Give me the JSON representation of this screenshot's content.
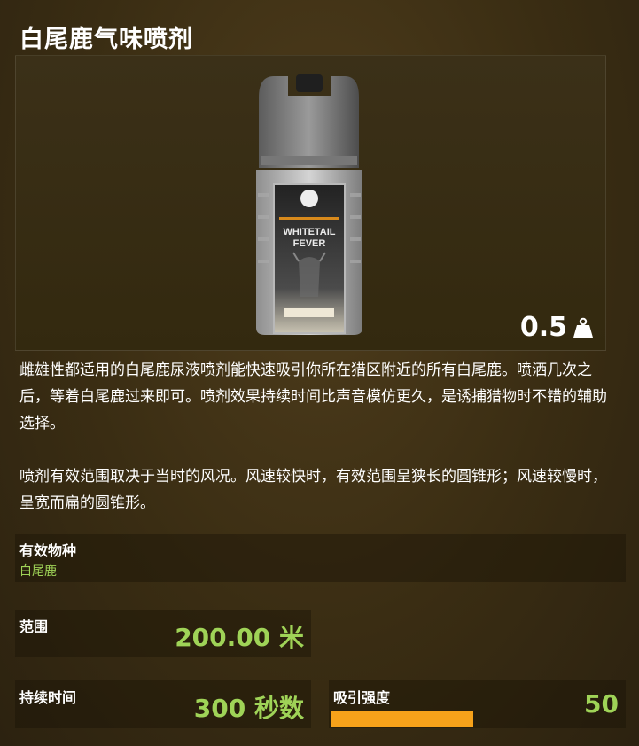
{
  "title": "白尾鹿气味喷剂",
  "image": {
    "product_label_line1": "WHITETAIL",
    "product_label_line2": "FEVER",
    "weight": "0.5",
    "weight_icon": "weight-icon"
  },
  "description": {
    "paragraph1": "雌雄性都适用的白尾鹿尿液喷剂能快速吸引你所在猎区附近的所有白尾鹿。喷洒几次之后，等着白尾鹿过来即可。喷剂效果持续时间比声音模仿更久，是诱捕猎物时不错的辅助选择。",
    "paragraph2": "喷剂有效范围取决于当时的风况。风速较快时，有效范围呈狭长的圆锥形；风速较慢时，呈宽而扁的圆锥形。"
  },
  "stats": {
    "species_label": "有效物种",
    "species_value": "白尾鹿",
    "range_label": "范围",
    "range_value": "200.00 米",
    "duration_label": "持续时间",
    "duration_value": "300 秒数",
    "attraction_label": "吸引强度",
    "attraction_value": "50",
    "attraction_fraction": 0.5
  },
  "colors": {
    "accent_green": "#9fd357",
    "bar_orange": "#f7a21a",
    "background": "#3a2d13"
  }
}
